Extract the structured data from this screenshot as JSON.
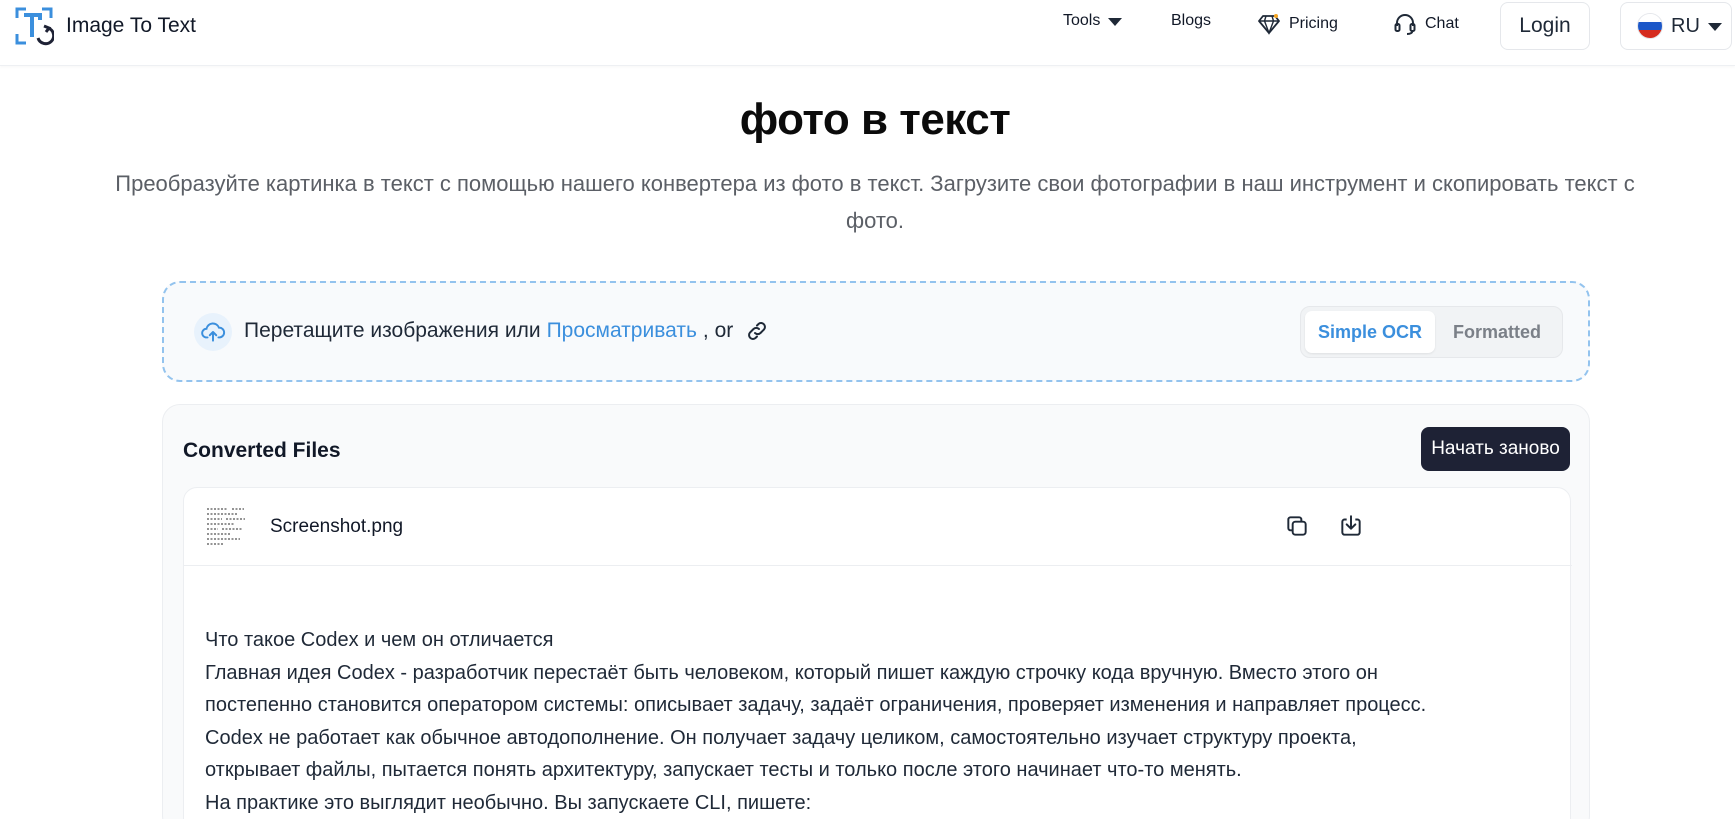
{
  "header": {
    "brand": "Image To Text",
    "nav": {
      "tools": "Tools",
      "blogs": "Blogs",
      "pricing": "Pricing",
      "chat": "Chat"
    },
    "login": "Login",
    "language": "RU"
  },
  "hero": {
    "title": "фото в текст",
    "subtitle_line1": "Преобразуйте картинка в текст с помощью нашего конвертера из фото в текст. Загрузите свои фотографии в наш инструмент и скопировать текст с",
    "subtitle_line2": "фото."
  },
  "upload": {
    "drag_text": "Перетащите изображения или",
    "browse_link": "Просматривать",
    "or_text": ", or",
    "mode_simple": "Simple OCR",
    "mode_formatted": "Formatted"
  },
  "converted": {
    "title": "Converted Files",
    "restart_button": "Начать заново",
    "file": {
      "name": "Screenshot.png"
    },
    "text_lines": [
      "Что такое Codex и чем он отличается",
      "Главная идея Codex - разработчик перестаёт быть человеком, который пишет каждую строчку кода вручную. Вместо этого он",
      "постепенно становится оператором системы: описывает задачу, задаёт ограничения, проверяет изменения и направляет процесс.",
      "Codex не работает как обычное автодополнение. Он получает задачу целиком, самостоятельно изучает структуру проекта,",
      "открывает файлы, пытается понять архитектуру, запускает тесты и только после этого начинает что-то менять.",
      "На практике это выглядит необычно. Вы запускаете CLI, пишете:"
    ]
  },
  "colors": {
    "accent_blue": "#3b8fdd",
    "dark_button": "#1e2235",
    "dashed_border": "#93c3ee"
  }
}
